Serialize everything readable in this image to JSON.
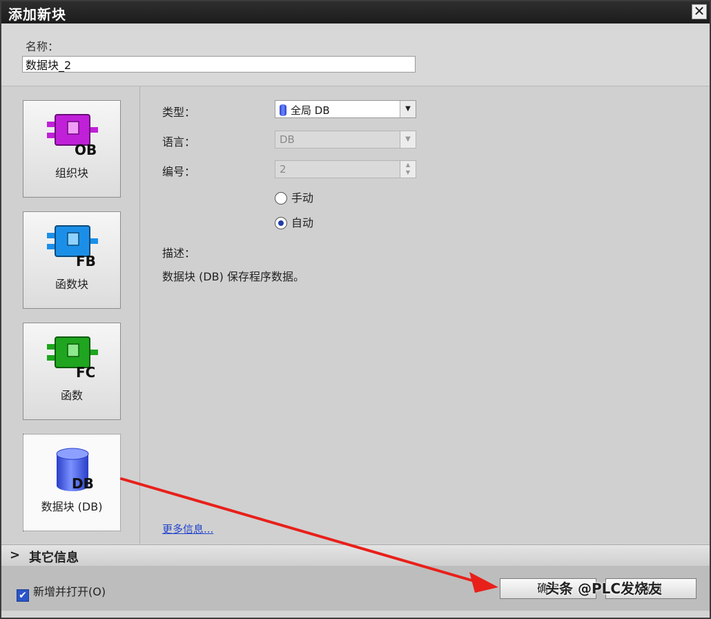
{
  "dialog": {
    "title": "添加新块"
  },
  "name_field": {
    "label": "名称：",
    "value": "数据块_2"
  },
  "blocks": [
    {
      "label": "组织块",
      "code": "OB",
      "color": "#c020d8",
      "selected": false
    },
    {
      "label": "函数块",
      "code": "FB",
      "color": "#1b8fe8",
      "selected": false
    },
    {
      "label": "函数",
      "code": "FC",
      "color": "#1fa51f",
      "selected": false
    },
    {
      "label": "数据块 (DB)",
      "code": "DB",
      "color": "#3550e0",
      "selected": true
    }
  ],
  "form": {
    "type_label": "类型：",
    "type_value": "全局 DB",
    "lang_label": "语言：",
    "lang_value": "DB",
    "number_label": "编号：",
    "number_value": "2",
    "radio_manual": "手动",
    "radio_auto": "自动",
    "radio_selected": "auto",
    "desc_label": "描述：",
    "desc_text": "数据块 (DB) 保存程序数据。",
    "more_link": "更多信息..."
  },
  "other_info": {
    "chevron": ">",
    "label": "其它信息"
  },
  "footer": {
    "checkbox_label": "新增并打开(O)",
    "checkbox_checked": true,
    "ok_label": "确定",
    "cancel_label": "取消"
  },
  "watermark": {
    "text": "头条 @PLC发烧友"
  },
  "annotation_color": "#e8201a"
}
